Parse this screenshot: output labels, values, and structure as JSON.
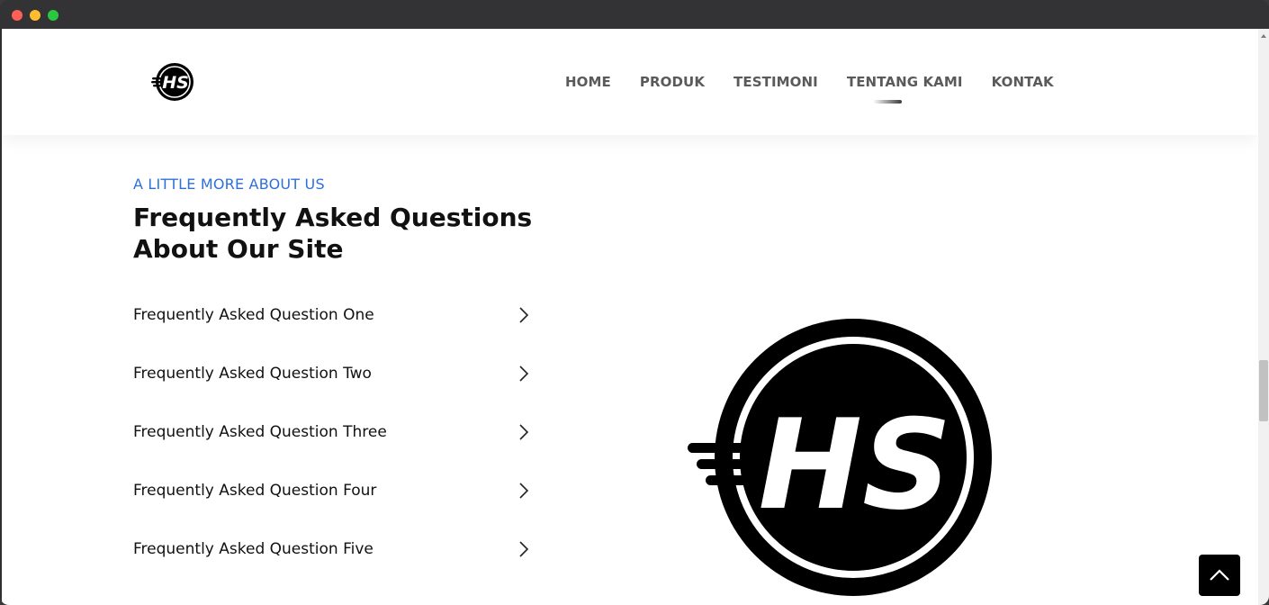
{
  "header": {
    "logo_text": "HS",
    "nav": [
      {
        "label": "HOME"
      },
      {
        "label": "PRODUK"
      },
      {
        "label": "TESTIMONI"
      },
      {
        "label": "TENTANG KAMI"
      },
      {
        "label": "KONTAK"
      }
    ],
    "active_nav": "TENTANG KAMI"
  },
  "faq_section": {
    "eyebrow": "A LITTLE MORE ABOUT US",
    "title": "Frequently Asked Questions About Our Site",
    "items": [
      {
        "question": "Frequently Asked Question One"
      },
      {
        "question": "Frequently Asked Question Two"
      },
      {
        "question": "Frequently Asked Question Three"
      },
      {
        "question": "Frequently Asked Question Four"
      },
      {
        "question": "Frequently Asked Question Five"
      }
    ]
  },
  "brand_image": {
    "text": "HS"
  },
  "back_to_top": {
    "icon": "chevron-up-icon"
  },
  "colors": {
    "accent": "#2f6fdc",
    "heading": "#111111",
    "nav": "#5a5a5a",
    "back_to_top_bg": "#000000"
  }
}
